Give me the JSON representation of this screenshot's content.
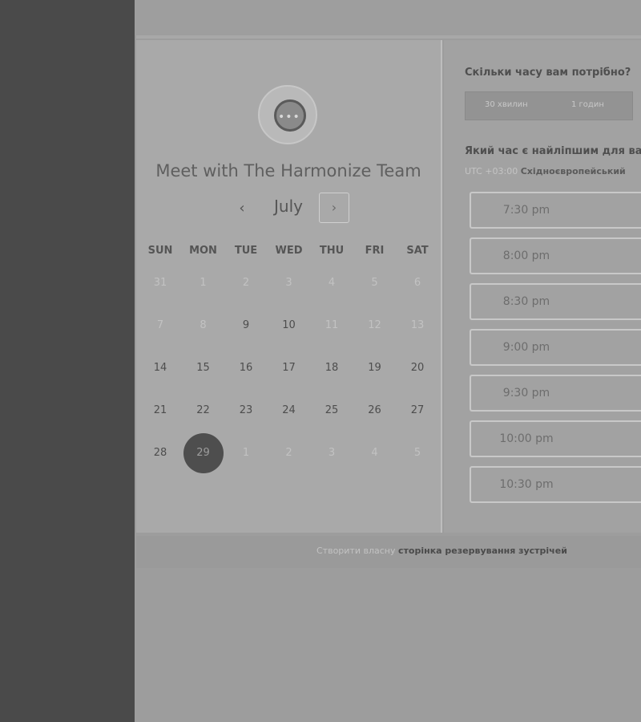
{
  "booking": {
    "title": "Meet with The Harmonize Team",
    "month": "July",
    "prev_icon": "‹",
    "next_icon": "›",
    "weekdays": [
      "SUN",
      "MON",
      "TUE",
      "WED",
      "THU",
      "FRI",
      "SAT"
    ],
    "weeks": [
      [
        {
          "d": "31",
          "s": "past"
        },
        {
          "d": "1",
          "s": "past"
        },
        {
          "d": "2",
          "s": "past"
        },
        {
          "d": "3",
          "s": "past"
        },
        {
          "d": "4",
          "s": "past"
        },
        {
          "d": "5",
          "s": "past"
        },
        {
          "d": "6",
          "s": "past"
        }
      ],
      [
        {
          "d": "7",
          "s": "past"
        },
        {
          "d": "8",
          "s": "past"
        },
        {
          "d": "9",
          "s": "avail"
        },
        {
          "d": "10",
          "s": "avail"
        },
        {
          "d": "11",
          "s": "past"
        },
        {
          "d": "12",
          "s": "past"
        },
        {
          "d": "13",
          "s": "past"
        }
      ],
      [
        {
          "d": "14",
          "s": "avail"
        },
        {
          "d": "15",
          "s": "avail"
        },
        {
          "d": "16",
          "s": "avail"
        },
        {
          "d": "17",
          "s": "avail"
        },
        {
          "d": "18",
          "s": "avail"
        },
        {
          "d": "19",
          "s": "avail"
        },
        {
          "d": "20",
          "s": "avail"
        }
      ],
      [
        {
          "d": "21",
          "s": "avail"
        },
        {
          "d": "22",
          "s": "avail"
        },
        {
          "d": "23",
          "s": "avail"
        },
        {
          "d": "24",
          "s": "avail"
        },
        {
          "d": "25",
          "s": "avail"
        },
        {
          "d": "26",
          "s": "avail"
        },
        {
          "d": "27",
          "s": "avail"
        }
      ],
      [
        {
          "d": "28",
          "s": "avail"
        },
        {
          "d": "29",
          "s": "selected"
        },
        {
          "d": "1",
          "s": "past"
        },
        {
          "d": "2",
          "s": "past"
        },
        {
          "d": "3",
          "s": "past"
        },
        {
          "d": "4",
          "s": "past"
        },
        {
          "d": "5",
          "s": "past"
        }
      ]
    ]
  },
  "scheduler": {
    "duration_question": "Скільки часу вам потрібно?",
    "durations": [
      "30 хвилин",
      "1 годин"
    ],
    "time_question": "Який час є найліпшим для ва",
    "timezone_prefix": "UTC +03:00",
    "timezone_name": "Східноєвропейський",
    "slots": [
      "7:30 pm",
      "8:00 pm",
      "8:30 pm",
      "9:00 pm",
      "9:30 pm",
      "10:00 pm",
      "10:30 pm"
    ]
  },
  "footer": {
    "prefix": "Створити власну",
    "link": "сторінка резервування зустрічей"
  },
  "colors": {
    "selected_day": "#4e4e4e",
    "sidebar": "#4a4a4a"
  }
}
